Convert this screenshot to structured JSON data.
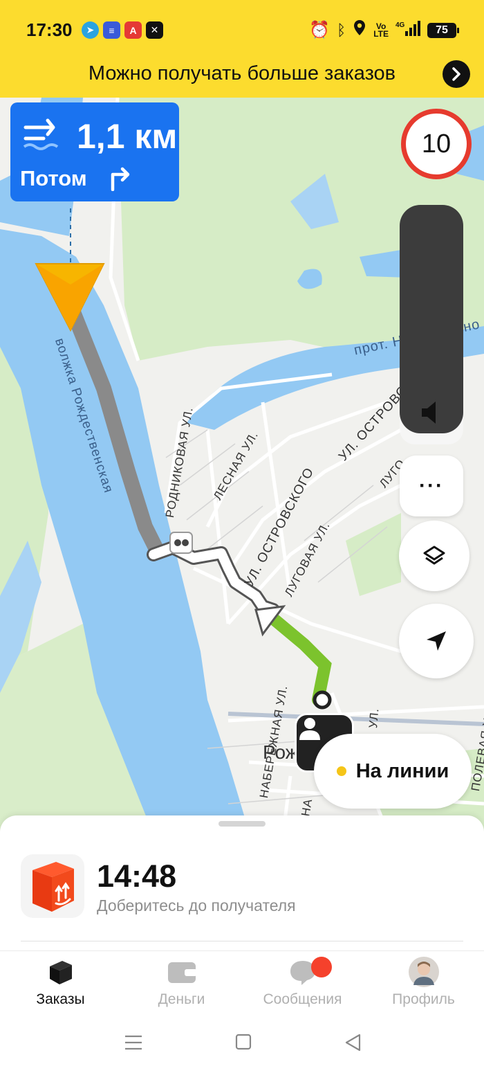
{
  "status_bar": {
    "time": "17:30",
    "app_icons": [
      "telegram-icon",
      "notes-icon",
      "a-app-icon",
      "close-app-icon"
    ],
    "system_icons": [
      "alarm-icon",
      "bluetooth-icon",
      "location-icon",
      "volte-icon",
      "signal-4g-icon"
    ],
    "volte_label": "Vo\nLTE",
    "battery": "75"
  },
  "promo": {
    "text": "Можно получать больше заказов",
    "arrow": "›"
  },
  "maneuver": {
    "distance": "1,1 км",
    "next_label": "Потом",
    "color": "#1a73f0"
  },
  "speed_limit": "10",
  "map": {
    "place_label": "Рож    ено",
    "streets": [
      "волжка Рождественская",
      "РОДНИКОВАЯ УЛ.",
      "ЛЕСНАЯ УЛ.",
      "УЛ. ОСТРОВСКОГО",
      "ЛУГОВАЯ УЛ.",
      "УЛ. ОСТРОВСКОГО",
      "ЛУГО",
      "прот. Недошивино",
      "НАБЕРЕЖНАЯ УЛ.",
      "КИНА",
      "УЛ.",
      "ПОЛЕВАЯ УЛ."
    ]
  },
  "controls": {
    "more_label": "···",
    "layers_icon": "layers-icon",
    "locate_icon": "navigation-arrow-icon"
  },
  "status_pill": {
    "label": "На линии",
    "dot_color": "#f5c518"
  },
  "sheet": {
    "eta": "14:48",
    "subtitle": "Доберитесь до получателя"
  },
  "tabs": [
    {
      "label": "Заказы",
      "active": true
    },
    {
      "label": "Деньги",
      "active": false
    },
    {
      "label": "Сообщения",
      "active": false
    },
    {
      "label": "Профиль",
      "active": false
    }
  ]
}
